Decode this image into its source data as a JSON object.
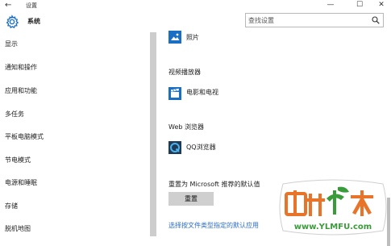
{
  "window": {
    "title": "设置",
    "back_glyph": "←",
    "minimize_glyph": "—",
    "maximize_glyph": "☐",
    "close_glyph": "✕"
  },
  "header": {
    "section_title": "系统",
    "search_placeholder": "查找设置"
  },
  "sidebar": {
    "items": [
      {
        "label": "显示"
      },
      {
        "label": "通知和操作"
      },
      {
        "label": "应用和功能"
      },
      {
        "label": "多任务"
      },
      {
        "label": "平板电脑模式"
      },
      {
        "label": "节电模式"
      },
      {
        "label": "电源和睡眠"
      },
      {
        "label": "存储"
      },
      {
        "label": "脱机地图"
      }
    ]
  },
  "main": {
    "photos_app": "照片",
    "video_heading": "视频播放器",
    "video_app": "电影和电视",
    "web_heading": "Web 浏览器",
    "web_app": "QQ浏览器",
    "reset_heading": "重置为 Microsoft 推荐的默认值",
    "reset_button": "重置",
    "choose_by_filetype_link": "选择按文件类型指定的默认应用"
  },
  "watermark": {
    "brand": "雨林木风",
    "url": "www.YLMFU.com"
  },
  "colors": {
    "accent": "#1a6fc4",
    "link": "#2c6ebf",
    "reset_button_bg": "#cfcfcf",
    "watermark_orange": "#e8742a",
    "watermark_green": "#3a9b3a"
  }
}
